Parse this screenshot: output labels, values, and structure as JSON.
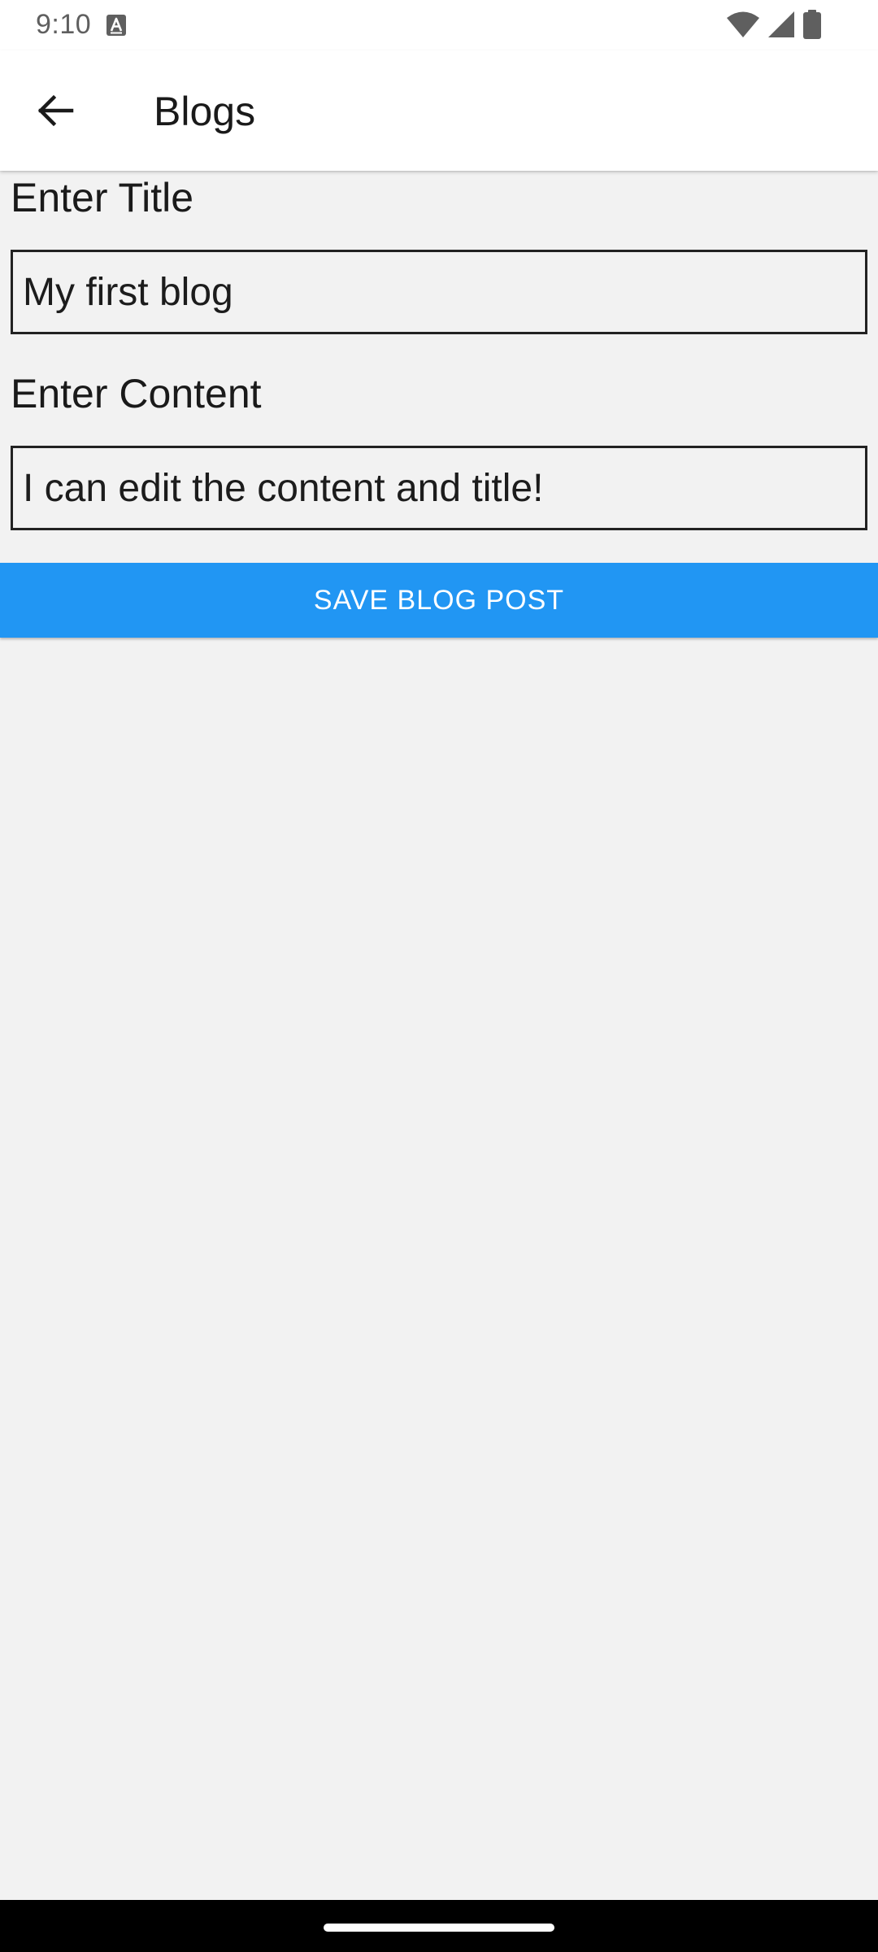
{
  "status_bar": {
    "time": "9:10",
    "icons": [
      "text-notification-icon",
      "wifi-icon",
      "cellular-signal-icon",
      "battery-icon"
    ]
  },
  "app_bar": {
    "back_icon": "arrow-back-icon",
    "title": "Blogs"
  },
  "form": {
    "title_label": "Enter Title",
    "title_value": "My first blog",
    "content_label": "Enter Content",
    "content_value": "I can edit the content and title!",
    "save_label": "SAVE BLOG POST"
  },
  "colors": {
    "accent": "#2196f3",
    "background": "#f2f2f2",
    "app_bar": "#ffffff",
    "nav_bar": "#000000"
  }
}
